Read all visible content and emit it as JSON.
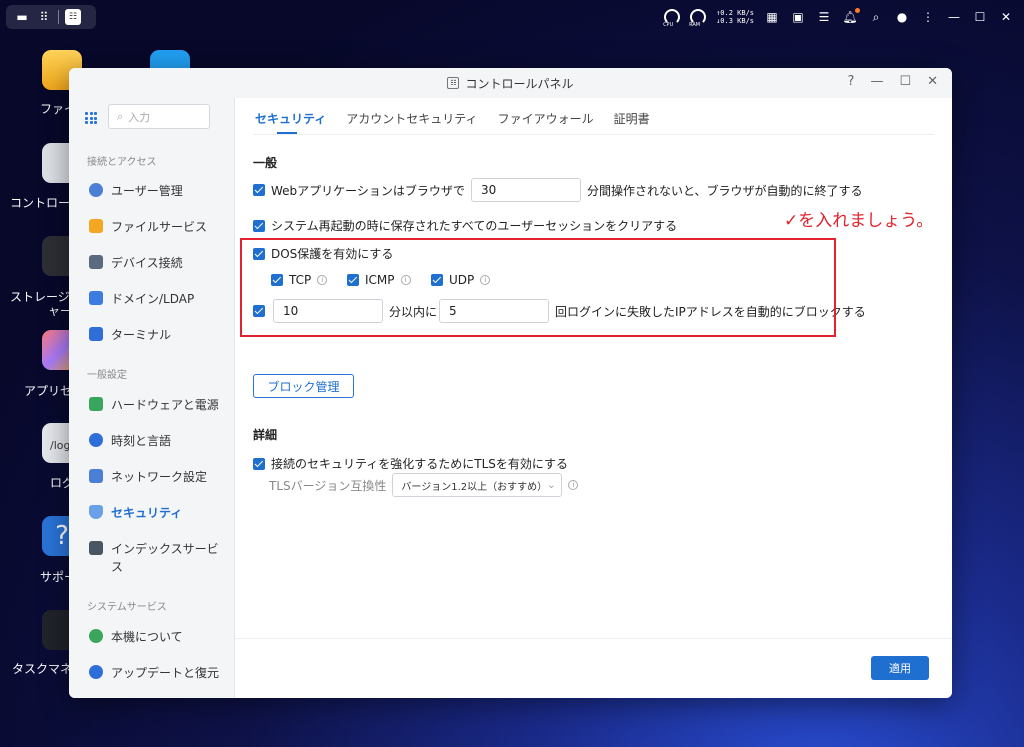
{
  "topbar": {
    "net_up": "0.2 KB/s",
    "net_down": "0.3 KB/s",
    "gauge_cpu": "CPU",
    "gauge_ram": "RAM"
  },
  "desktop": {
    "icons": [
      {
        "label": "ファイ"
      },
      {
        "label": "コントロー"
      },
      {
        "label": "ストレージ"
      },
      {
        "label": "ャー"
      },
      {
        "label": "アプリセ"
      },
      {
        "label": "ログ"
      },
      {
        "label": "サポー"
      },
      {
        "label": "タスクマネー"
      }
    ],
    "log_text": "/log"
  },
  "window": {
    "title": "コントロールパネル",
    "help": "?",
    "sidebar": {
      "search_placeholder": "入力",
      "sections": [
        {
          "title": "接続とアクセス",
          "items": [
            {
              "label": "ユーザー管理"
            },
            {
              "label": "ファイルサービス"
            },
            {
              "label": "デバイス接続"
            },
            {
              "label": "ドメイン/LDAP"
            },
            {
              "label": "ターミナル"
            }
          ]
        },
        {
          "title": "一般設定",
          "items": [
            {
              "label": "ハードウェアと電源"
            },
            {
              "label": "時刻と言語"
            },
            {
              "label": "ネットワーク設定"
            },
            {
              "label": "セキュリティ"
            },
            {
              "label": "インデックスサービ"
            },
            {
              "label": "ス"
            }
          ]
        },
        {
          "title": "システムサービス",
          "items": [
            {
              "label": "本機について"
            },
            {
              "label": "アップデートと復元"
            }
          ]
        }
      ]
    },
    "tabs": [
      {
        "label": "セキュリティ"
      },
      {
        "label": "アカウントセキュリティ"
      },
      {
        "label": "ファイアウォール"
      },
      {
        "label": "証明書"
      }
    ],
    "general": {
      "heading": "一般",
      "web_timeout_prefix": "Webアプリケーションはブラウザで",
      "web_timeout_value": "30",
      "web_timeout_suffix": "分間操作されないと、ブラウザが自動的に終了する",
      "clear_sessions": "システム再起動の時に保存されたすべてのユーザーセッションをクリアする",
      "dos_label": "DOS保護を有効にする",
      "proto_tcp": "TCP",
      "proto_icmp": "ICMP",
      "proto_udp": "UDP",
      "block_minutes": "10",
      "block_mid": "分以内に",
      "block_count": "5",
      "block_suffix": "回ログインに失敗したIPアドレスを自動的にブロックする",
      "block_manage_button": "ブロック管理"
    },
    "advanced": {
      "heading": "詳細",
      "tls_label": "接続のセキュリティを強化するためにTLSを有効にする",
      "tls_compat_label": "TLSバージョン互換性",
      "tls_compat_value": "バージョン1.2以上（おすすめ）"
    },
    "apply_button": "適用"
  },
  "annotation": {
    "text": "✓を入れましょう。",
    "color": "#e0232e"
  },
  "colors": {
    "accent": "#1f6fd1"
  }
}
